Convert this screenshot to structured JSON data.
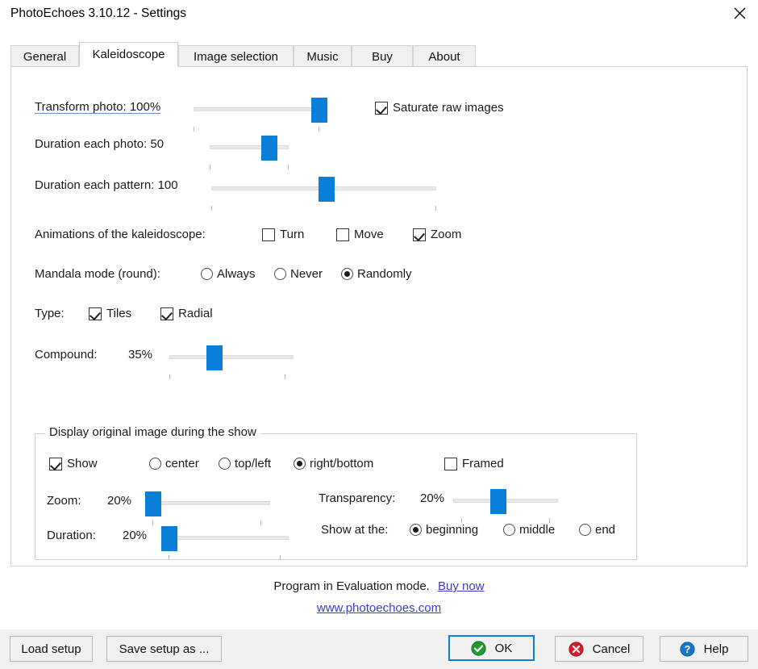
{
  "window": {
    "title": "PhotoEchoes 3.10.12  -  Settings",
    "close_icon": "close-icon"
  },
  "tabs": [
    {
      "label": "General",
      "active": false
    },
    {
      "label": "Kaleidoscope",
      "active": true
    },
    {
      "label": "Image selection",
      "active": false
    },
    {
      "label": "Music",
      "active": false
    },
    {
      "label": "Buy",
      "active": false
    },
    {
      "label": "About",
      "active": false
    }
  ],
  "sliders": {
    "transform_photo": {
      "label": "Transform photo: 100%",
      "value": 100
    },
    "duration_each_photo": {
      "label": "Duration each photo: 50",
      "value": 50
    },
    "duration_each_pattern": {
      "label": "Duration each pattern: 100",
      "value": 100
    },
    "compound": {
      "label": "Compound:",
      "value_text": "35%",
      "value": 35
    }
  },
  "saturate": {
    "label": "Saturate raw images",
    "checked": true
  },
  "animations": {
    "label": "Animations of the kaleidoscope:",
    "options": [
      {
        "label": "Turn",
        "checked": false
      },
      {
        "label": "Move",
        "checked": false
      },
      {
        "label": "Zoom",
        "checked": true
      }
    ]
  },
  "mandala": {
    "label": "Mandala mode (round):",
    "options": [
      {
        "label": "Always",
        "selected": false
      },
      {
        "label": "Never",
        "selected": false
      },
      {
        "label": "Randomly",
        "selected": true
      }
    ]
  },
  "type": {
    "label": "Type:",
    "options": [
      {
        "label": "Tiles",
        "checked": true
      },
      {
        "label": "Radial",
        "checked": true
      }
    ]
  },
  "display_group": {
    "title": "Display original image during the show",
    "show": {
      "label": "Show",
      "checked": true
    },
    "position": {
      "options": [
        {
          "label": "center",
          "selected": false
        },
        {
          "label": "top/left",
          "selected": false
        },
        {
          "label": "right/bottom",
          "selected": true
        }
      ]
    },
    "framed": {
      "label": "Framed",
      "checked": false
    },
    "zoom": {
      "label": "Zoom:",
      "value_text": "20%",
      "value": 20
    },
    "duration": {
      "label": "Duration:",
      "value_text": "20%",
      "value": 20
    },
    "transparency": {
      "label": "Transparency:",
      "value_text": "20%",
      "value": 20
    },
    "show_at_the": {
      "label": "Show at the:",
      "options": [
        {
          "label": "beginning",
          "selected": true
        },
        {
          "label": "middle",
          "selected": false
        },
        {
          "label": "end",
          "selected": false
        }
      ]
    }
  },
  "footer": {
    "eval_text": "Program in Evaluation mode.",
    "buy_now": "Buy now",
    "website": "www.photoechoes.com"
  },
  "buttons": {
    "load_setup": "Load setup",
    "save_setup_as": "Save setup as ...",
    "ok": "OK",
    "cancel": "Cancel",
    "help": "Help"
  },
  "colors": {
    "accent": "#0a7fd8",
    "link": "#3a3ad0",
    "ok_green": "#1f9a2e",
    "cancel_red": "#d41f2e",
    "help_blue": "#1878c8"
  }
}
